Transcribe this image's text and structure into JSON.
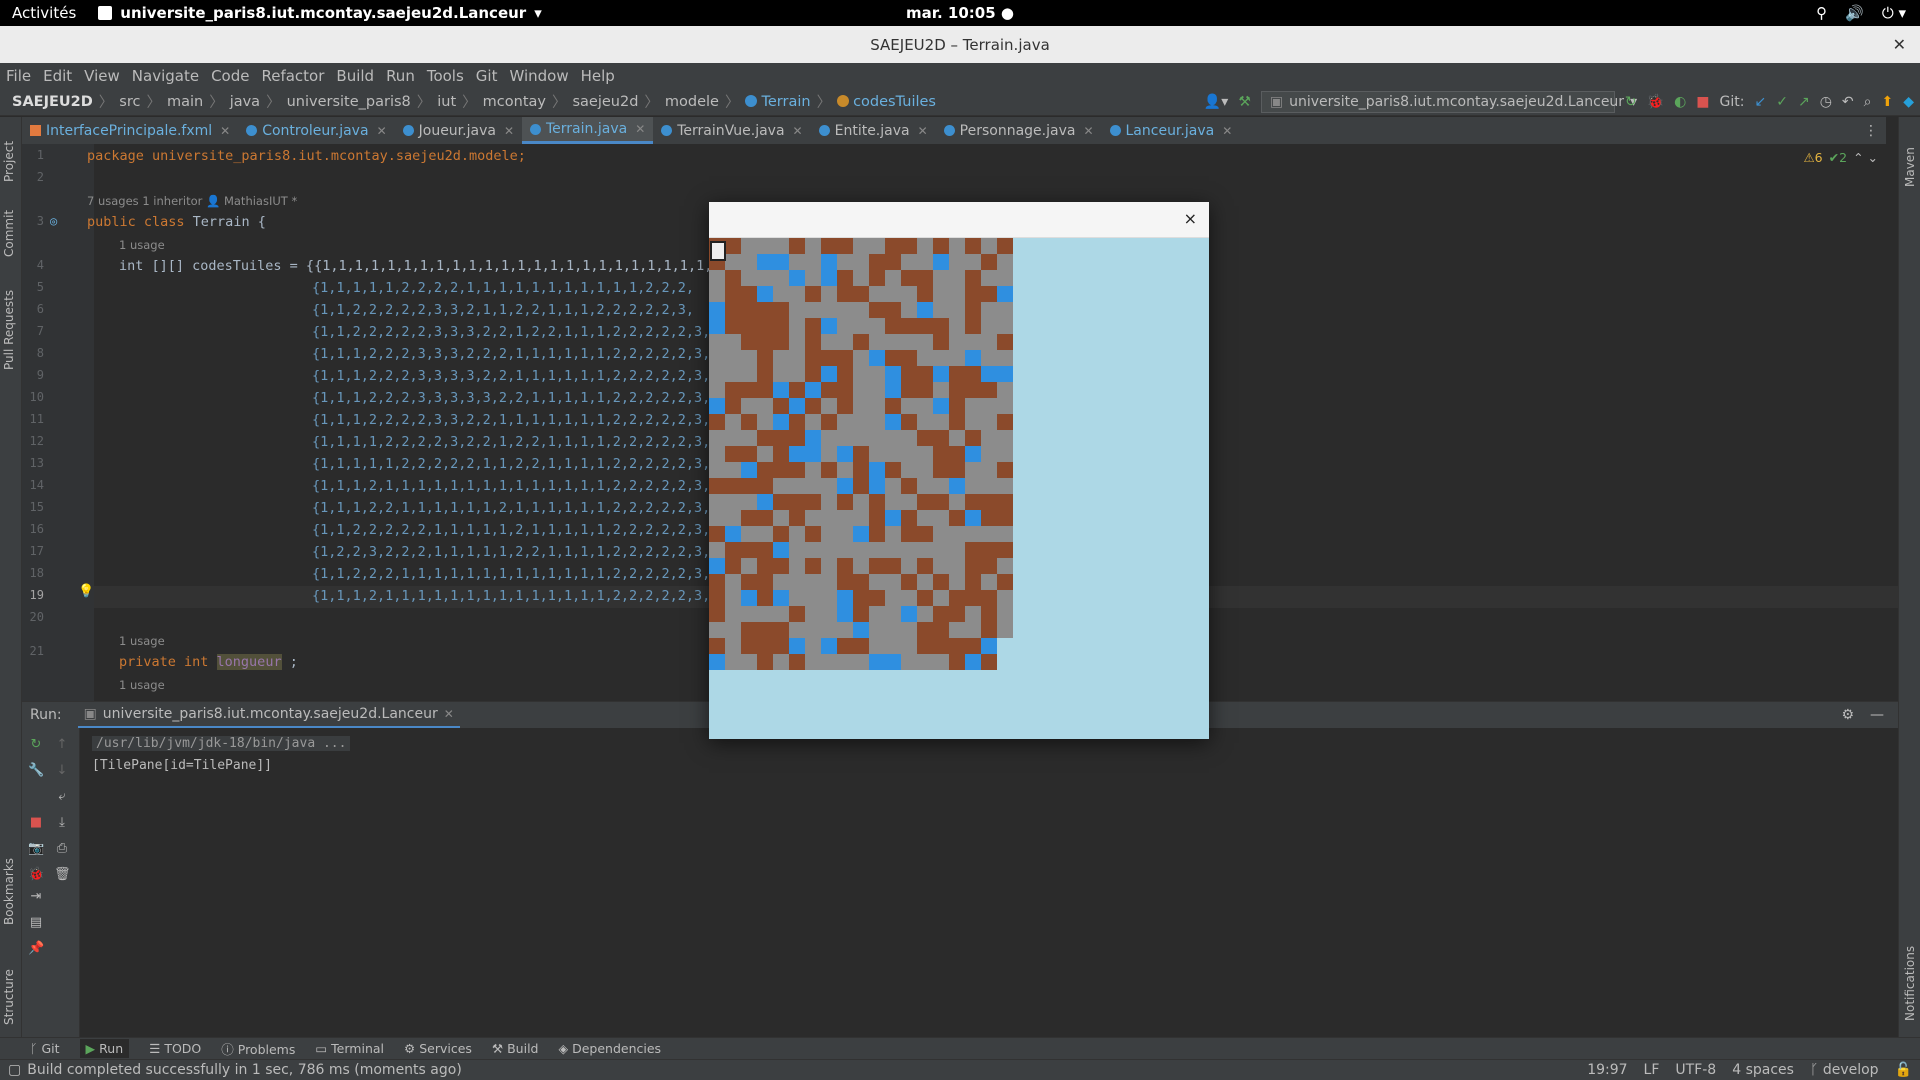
{
  "gnome": {
    "activities": "Activités",
    "app_name": "universite_paris8.iut.mcontay.saejeu2d.Lanceur",
    "clock": "mar. 10:05 ●"
  },
  "window": {
    "title": "SAEJEU2D – Terrain.java"
  },
  "menu": [
    "File",
    "Edit",
    "View",
    "Navigate",
    "Code",
    "Refactor",
    "Build",
    "Run",
    "Tools",
    "Git",
    "Window",
    "Help"
  ],
  "breadcrumb": [
    "SAEJEU2D",
    "src",
    "main",
    "java",
    "universite_paris8",
    "iut",
    "mcontay",
    "saejeu2d",
    "modele"
  ],
  "breadcrumb_class": "Terrain",
  "breadcrumb_field": "codesTuiles",
  "run_config": "universite_paris8.iut.mcontay.saejeu2d.Lanceur",
  "git_label": "Git:",
  "tabs": [
    "InterfacePrincipale.fxml",
    "Controleur.java",
    "Joueur.java",
    "Terrain.java",
    "TerrainVue.java",
    "Entite.java",
    "Personnage.java",
    "Lanceur.java"
  ],
  "active_tab": "Terrain.java",
  "left_strip": [
    "Project",
    "Commit",
    "Pull Requests",
    "Bookmarks",
    "Structure"
  ],
  "right_strip": [
    "Maven",
    "Notifications"
  ],
  "inspections": {
    "warnings": "⚠6",
    "ok": "✔2"
  },
  "editor": {
    "line1": "package universite_paris8.iut.mcontay.saejeu2d.modele;",
    "hint1": "7 usages   1 inheritor   👤 MathiasIUT *",
    "line3_kw": "public class",
    "line3_rest": " Terrain {",
    "usage1": "1 usage",
    "line4": "int [][] codesTuiles = {{1,1,1,1,1,1,1,1,1,1,1,1,1,1,1,1,1,1,1,1,1,1,1,1,1,",
    "rows": [
      "{1,1,1,1,1,2,2,2,2,1,1,1,1,1,1,1,1,1,1,1,2,2,2,",
      "{1,1,2,2,2,2,2,3,3,2,1,1,2,2,1,1,1,2,2,2,2,2,3,",
      "{1,1,2,2,2,2,2,3,3,3,2,2,1,2,2,1,1,1,2,2,2,2,2,3,",
      "{1,1,1,2,2,2,3,3,3,2,2,2,1,1,1,1,1,1,2,2,2,2,2,3,",
      "{1,1,1,2,2,2,3,3,3,3,2,2,1,1,1,1,1,1,2,2,2,2,2,3,",
      "{1,1,1,2,2,2,3,3,3,3,3,2,2,1,1,1,1,1,2,2,2,2,2,3,",
      "{1,1,1,2,2,2,2,3,3,2,2,1,1,1,1,1,1,1,2,2,2,2,2,3,",
      "{1,1,1,1,2,2,2,2,3,2,2,1,2,2,1,1,1,1,2,2,2,2,2,3,",
      "{1,1,1,1,1,2,2,2,2,2,1,1,2,2,1,1,1,1,2,2,2,2,2,3,",
      "{1,1,1,2,1,1,1,1,1,1,1,1,1,1,1,1,1,1,2,2,2,2,2,3,",
      "{1,1,1,2,2,1,1,1,1,1,1,2,1,1,1,1,1,1,2,2,2,2,2,3,",
      "{1,1,2,2,2,2,2,1,1,1,1,1,2,1,1,1,1,1,2,2,2,2,2,3,",
      "{1,2,2,3,2,2,2,1,1,1,1,1,2,2,1,1,1,1,2,2,2,2,2,3,",
      "{1,1,2,2,2,1,1,1,1,1,1,1,1,1,1,1,1,1,2,2,2,2,2,3,",
      "{1,1,1,2,1,1,1,1,1,1,1,1,1,1,1,1,1,1,2,2,2,2,2,3,"
    ],
    "usage21": "1 usage",
    "line21_kw": "private int",
    "line21_fld": "longueur",
    "line21_end": " ;",
    "usage22": "1 usage",
    "line_numbers": [
      "1",
      "2",
      "3",
      "4",
      "5",
      "6",
      "7",
      "8",
      "9",
      "10",
      "11",
      "12",
      "13",
      "14",
      "15",
      "16",
      "17",
      "18",
      "19",
      "20",
      "21"
    ]
  },
  "run": {
    "label": "Run:",
    "tab": "universite_paris8.iut.mcontay.saejeu2d.Lanceur",
    "cmd": "/usr/lib/jvm/jdk-18/bin/java ...",
    "output": "[TilePane[id=TilePane]]"
  },
  "toolwindows": [
    "Git",
    "Run",
    "TODO",
    "Problems",
    "Terminal",
    "Services",
    "Build",
    "Dependencies"
  ],
  "status": {
    "message": "Build completed successfully in 1 sec, 786 ms (moments ago)",
    "position": "19:97",
    "lf": "LF",
    "encoding": "UTF-8",
    "indent": "4 spaces",
    "branch": "develop"
  },
  "game": {
    "close": "×",
    "colors": {
      "sky": "#add8e6",
      "stone": "#8c8c8c",
      "dirt": "#8b4a2b",
      "water": "#2f8fe0"
    }
  }
}
